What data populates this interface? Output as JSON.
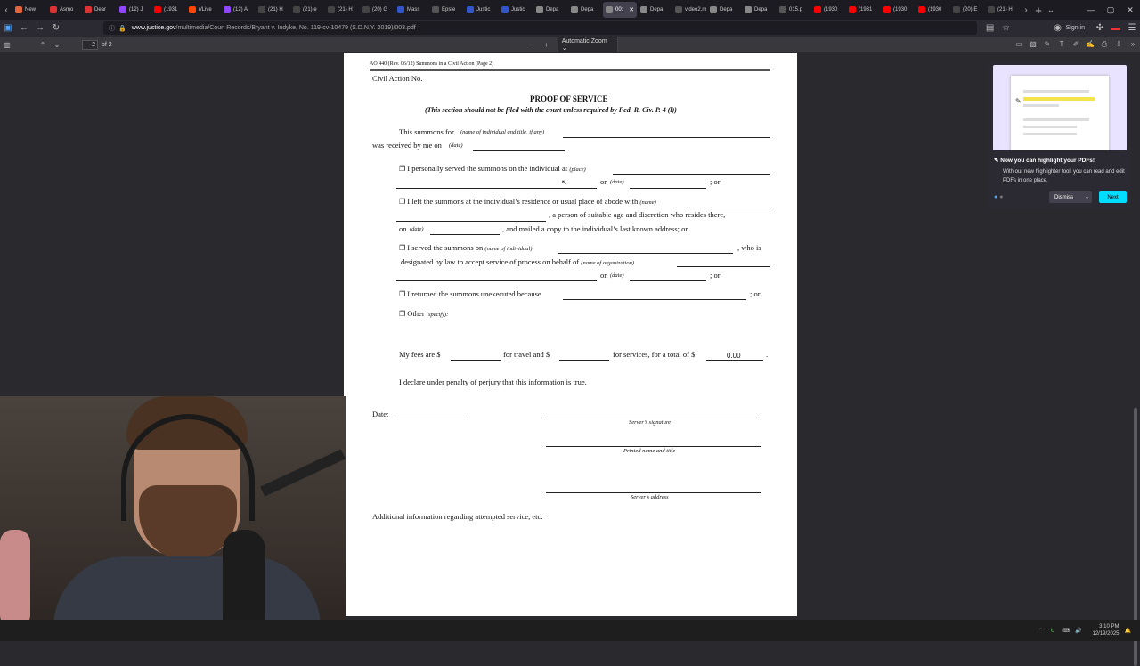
{
  "browser": {
    "tabs": [
      {
        "label": "New",
        "color": "#e0643c"
      },
      {
        "label": "Asmo",
        "color": "#d33"
      },
      {
        "label": "Dear",
        "color": "#d33"
      },
      {
        "label": "(12) J",
        "color": "#9146ff"
      },
      {
        "label": "(1931",
        "color": "#f00"
      },
      {
        "label": "r/Live",
        "color": "#ff4500"
      },
      {
        "label": "(12) A",
        "color": "#9146ff"
      },
      {
        "label": "(21) H",
        "color": "#444"
      },
      {
        "label": "(21) e",
        "color": "#444"
      },
      {
        "label": "(21) H",
        "color": "#444"
      },
      {
        "label": "(20) G",
        "color": "#444"
      },
      {
        "label": "Mass",
        "color": "#3355cc"
      },
      {
        "label": "Epste",
        "color": "#555"
      },
      {
        "label": "Justic",
        "color": "#3355cc"
      },
      {
        "label": "Justic",
        "color": "#3355cc"
      },
      {
        "label": "Depa",
        "color": "#888"
      },
      {
        "label": "Depa",
        "color": "#888"
      },
      {
        "label": "00:",
        "color": "#888",
        "active": true
      },
      {
        "label": "Depa",
        "color": "#888"
      },
      {
        "label": "video2.m",
        "color": "#555"
      },
      {
        "label": "Depa",
        "color": "#888"
      },
      {
        "label": "Depa",
        "color": "#888"
      },
      {
        "label": "015.p",
        "color": "#555"
      },
      {
        "label": "(1930",
        "color": "#f00"
      },
      {
        "label": "(1931",
        "color": "#f00"
      },
      {
        "label": "(1930",
        "color": "#f00"
      },
      {
        "label": "(1930",
        "color": "#f00"
      },
      {
        "label": "(20) E",
        "color": "#444"
      },
      {
        "label": "(21) H",
        "color": "#444"
      }
    ],
    "url_host": "www.justice.gov",
    "url_path": "/multimedia/Court Records/Bryant v. Indyke, No. 119-cv-10479 (S.D.N.Y. 2019)/003.pdf",
    "signin": "Sign in"
  },
  "pdf_toolbar": {
    "page": "2",
    "of": "of 2",
    "zoom": "Automatic Zoom"
  },
  "form": {
    "header": "AO 440 (Rev. 06/12)  Summons in a Civil Action (Page 2)",
    "civil_action": "Civil Action No.",
    "title": "PROOF OF SERVICE",
    "subtitle": "(This section should not be filed with the court unless required by Fed. R. Civ. P. 4 (l))",
    "summons_for": "This summons for",
    "name_title_hint": "(name of individual and title, if any)",
    "received_by": "was received by me on",
    "date_hint": "(date)",
    "opt1": "I personally served the summons on the individual at",
    "place_hint": "(place)",
    "on": "on",
    "or": "; or",
    "opt2": "I left the summons at the individual’s residence or usual place of abode with",
    "name_hint": "(name)",
    "opt2b": ", a person of suitable age and discretion who resides there,",
    "opt2c": ", and mailed a copy to the individual’s last known address; or",
    "opt3": "I served the summons on",
    "indiv_hint": "(name of individual)",
    "who_is": ", who is",
    "opt3b": "designated by law to accept service of process on behalf of",
    "org_hint": "(name of organization)",
    "opt4": "I returned the summons unexecuted because",
    "opt5": "Other",
    "specify_hint": "(specify):",
    "fees": "My fees are $",
    "for_travel": "for travel and $",
    "for_services": "for services, for a total of $",
    "total": "0.00",
    "declare": "I declare under penalty of perjury that this information is true.",
    "date_label": "Date:",
    "sig": "Server’s signature",
    "printed": "Printed name and title",
    "address": "Server’s address",
    "additional": "Additional information regarding attempted service, etc:"
  },
  "popup": {
    "title": "Now you can highlight your PDFs!",
    "body": "With our new highlighter tool, you can read and edit PDFs in one place.",
    "dismiss": "Dismiss",
    "next": "Next"
  },
  "taskbar": {
    "time": "3:10 PM",
    "date": "12/19/2025"
  }
}
